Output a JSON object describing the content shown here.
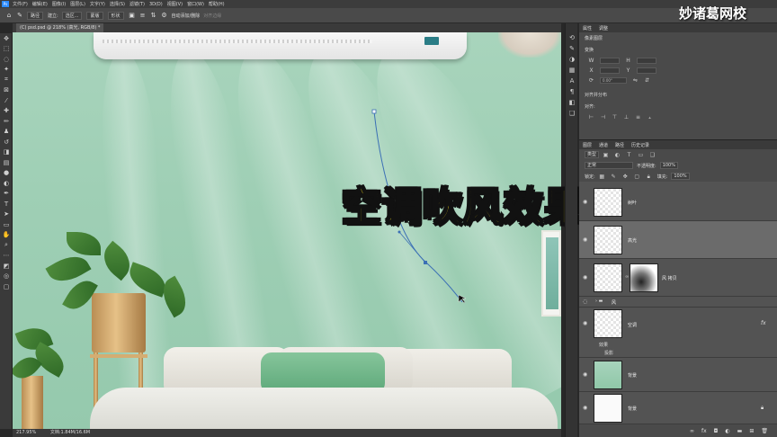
{
  "menu": {
    "logo": "Ps",
    "items": [
      "文件(F)",
      "编辑(E)",
      "图像(I)",
      "图层(L)",
      "文字(Y)",
      "选择(S)",
      "滤镜(T)",
      "3D(D)",
      "视图(V)",
      "窗口(W)",
      "帮助(H)"
    ]
  },
  "options": {
    "mode_select": "路径",
    "make_label": "建立:",
    "make_select": "选区...",
    "mask_button": "蒙版",
    "shape_button": "形状",
    "auto_add_delete": "自动添加/删除",
    "align_edges": "对齐边缘"
  },
  "document": {
    "tab_label": "(C) psd.psd @ 218% (高光, RGB/8) *"
  },
  "caption": "空调吹风效果",
  "watermark": "妙诸葛网校",
  "status": {
    "zoom": "217.95%",
    "doc": "文档:1.84M/16.6M"
  },
  "properties": {
    "tabs": [
      "属性",
      "调整"
    ],
    "section_title": "像素图层",
    "transform_title": "变换",
    "w_label": "W",
    "h_label": "H",
    "x_label": "X",
    "y_label": "Y",
    "angle": "0.00°",
    "align_title": "对齐并分布",
    "align_label": "对齐:"
  },
  "layers": {
    "tabs": [
      "图层",
      "通道",
      "路径",
      "历史记录"
    ],
    "filter": "类型",
    "blend_mode": "正常",
    "opacity_label": "不透明度:",
    "opacity": "100%",
    "lock_label": "锁定:",
    "fill_label": "填充:",
    "fill": "100%",
    "items": [
      {
        "name": "树叶"
      },
      {
        "name": "高光"
      },
      {
        "name": "风 拷贝"
      },
      {
        "name": "风"
      },
      {
        "name": "空调",
        "fx": "fx"
      },
      {
        "name": "背景"
      },
      {
        "name": "背景"
      }
    ],
    "effects_label": "效果",
    "projection_label": "投影"
  },
  "colors": {
    "accent": "#2d8cff",
    "caption": "#ffe81a",
    "panel": "#535353",
    "canvas": "#a8d4bc"
  }
}
